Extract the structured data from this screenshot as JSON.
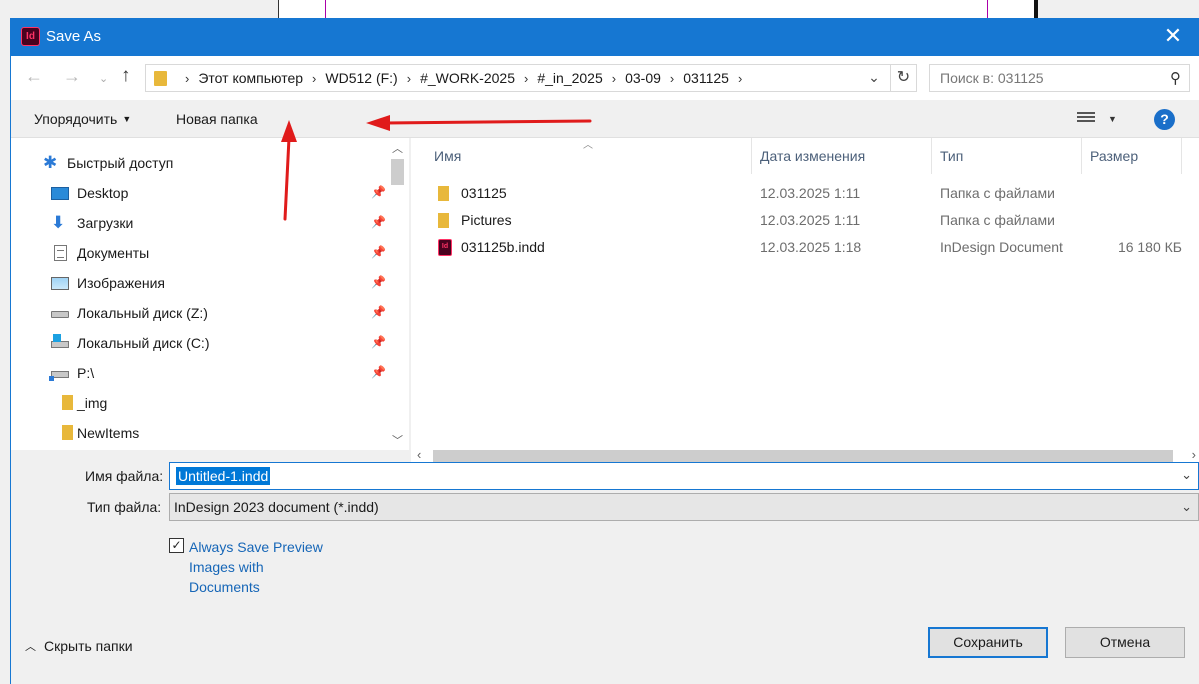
{
  "window": {
    "app_icon_text": "Id",
    "title": "Save As",
    "close_glyph": "✕"
  },
  "address": {
    "crumbs": [
      "Этот компьютер",
      "WD512 (F:)",
      "#_WORK-2025",
      "#_in_2025",
      "03-09",
      "031125"
    ],
    "search_placeholder": "Поиск в: 031125"
  },
  "toolbar": {
    "organize_label": "Упорядочить",
    "new_folder_label": "Новая папка",
    "help_label": "?"
  },
  "sidebar": {
    "quick_access": "Быстрый доступ",
    "items": [
      {
        "label": "Desktop",
        "icon": "desktop-icon",
        "pinned": true
      },
      {
        "label": "Загрузки",
        "icon": "download-arrow-icon",
        "pinned": true
      },
      {
        "label": "Документы",
        "icon": "document-icon",
        "pinned": true
      },
      {
        "label": "Изображения",
        "icon": "picture-icon",
        "pinned": true
      },
      {
        "label": "Локальный диск (Z:)",
        "icon": "drive-icon",
        "pinned": true
      },
      {
        "label": "Локальный диск (C:)",
        "icon": "windows-drive-icon",
        "pinned": true
      },
      {
        "label": "P:\\",
        "icon": "network-drive-icon",
        "pinned": true
      },
      {
        "label": "_img",
        "icon": "folder-icon",
        "pinned": false
      },
      {
        "label": "NewItems",
        "icon": "folder-icon",
        "pinned": false
      }
    ]
  },
  "files": {
    "columns": {
      "name": "Имя",
      "date": "Дата изменения",
      "type": "Тип",
      "size": "Размер"
    },
    "rows": [
      {
        "name": "031125",
        "date": "12.03.2025 1:11",
        "type": "Папка с файлами",
        "size": "",
        "icon": "folder-icon"
      },
      {
        "name": "Pictures",
        "date": "12.03.2025 1:11",
        "type": "Папка с файлами",
        "size": "",
        "icon": "folder-icon"
      },
      {
        "name": "031125b.indd",
        "date": "12.03.2025 1:18",
        "type": "InDesign Document",
        "size": "16 180 КБ",
        "icon": "indesign-file-icon"
      }
    ]
  },
  "form": {
    "filename_label": "Имя файла:",
    "filename_value": "Untitled-1.indd",
    "filetype_label": "Тип файла:",
    "filetype_value": "InDesign 2023 document (*.indd)",
    "preview_checked": true,
    "preview_line1": "Always Save Preview",
    "preview_line2": "Images with",
    "preview_line3": "Documents"
  },
  "footer": {
    "hide_folders_label": "Скрыть папки",
    "save_label": "Сохранить",
    "cancel_label": "Отмена"
  },
  "colors": {
    "accent": "#1677d2",
    "annotation_arrow": "#e01b1b"
  }
}
